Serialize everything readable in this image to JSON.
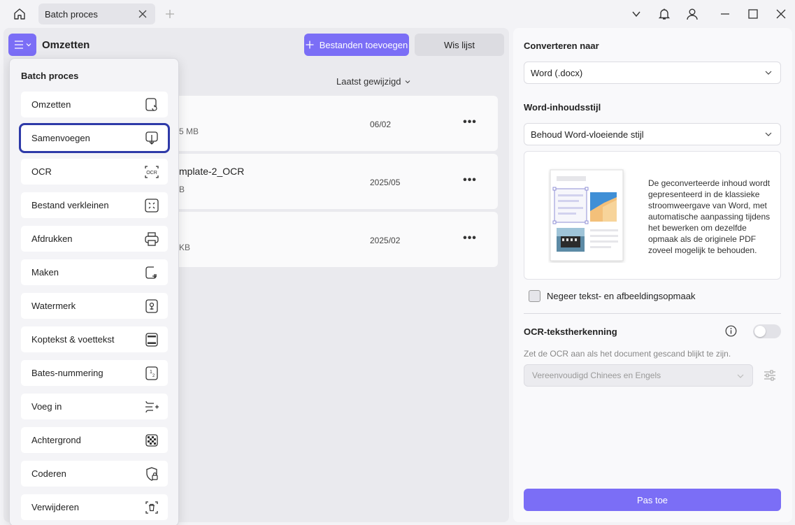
{
  "titlebar": {
    "tab_title": "Batch proces",
    "icons": [
      "home-icon",
      "close-icon",
      "plus-icon",
      "chevron-down-icon",
      "bell-icon",
      "user-icon",
      "minimize-icon",
      "maximize-icon",
      "close-window-icon"
    ]
  },
  "main": {
    "title": "Omzetten",
    "add_files_label": "Bestanden toevoegen",
    "clear_list_label": "Wis lijst",
    "sort_label": "Laatst gewijzigd",
    "files": [
      {
        "name": "",
        "size": "5 MB",
        "date": "06/02",
        "more": "•••"
      },
      {
        "name": "mplate-2_OCR",
        "size": "B",
        "date": "2025/05",
        "more": "•••"
      },
      {
        "name": "",
        "size": "KB",
        "date": "2025/02",
        "more": "•••"
      }
    ]
  },
  "batch_menu": {
    "title": "Batch proces",
    "items": [
      {
        "label": "Omzetten",
        "icon": "convert-icon"
      },
      {
        "label": "Samenvoegen",
        "icon": "merge-icon",
        "selected": true
      },
      {
        "label": "OCR",
        "icon": "ocr-icon"
      },
      {
        "label": "Bestand verkleinen",
        "icon": "compress-icon"
      },
      {
        "label": "Afdrukken",
        "icon": "print-icon"
      },
      {
        "label": "Maken",
        "icon": "create-icon"
      },
      {
        "label": "Watermerk",
        "icon": "watermark-icon"
      },
      {
        "label": "Koptekst & voettekst",
        "icon": "header-footer-icon"
      },
      {
        "label": "Bates-nummering",
        "icon": "bates-icon"
      },
      {
        "label": "Voeg in",
        "icon": "insert-icon"
      },
      {
        "label": "Achtergrond",
        "icon": "background-icon"
      },
      {
        "label": "Coderen",
        "icon": "encrypt-icon"
      },
      {
        "label": "Verwijderen",
        "icon": "delete-icon"
      }
    ]
  },
  "settings": {
    "convert_to_title": "Converteren naar",
    "convert_to_value": "Word (.docx)",
    "word_style_title": "Word-inhoudsstijl",
    "word_style_value": "Behoud Word-vloeiende stijl",
    "preview_description": "De geconverteerde inhoud wordt gepresenteerd in de klassieke stroomweergave van Word, met automatische aanpassing tijdens het bewerken om dezelfde opmaak als de originele PDF zoveel mogelijk te behouden.",
    "ignore_formatting_label": "Negeer tekst- en afbeeldingsopmaak",
    "ignore_formatting_checked": false,
    "ocr_title": "OCR-tekstherkenning",
    "ocr_enabled": false,
    "ocr_hint": "Zet de OCR aan als het document gescand blijkt te zijn.",
    "ocr_language": "Vereenvoudigd Chinees en Engels",
    "apply_label": "Pas toe"
  },
  "colors": {
    "accent": "#7b6ef6",
    "selected_outline": "#2e3aa8",
    "panel": "#eaeaee"
  }
}
